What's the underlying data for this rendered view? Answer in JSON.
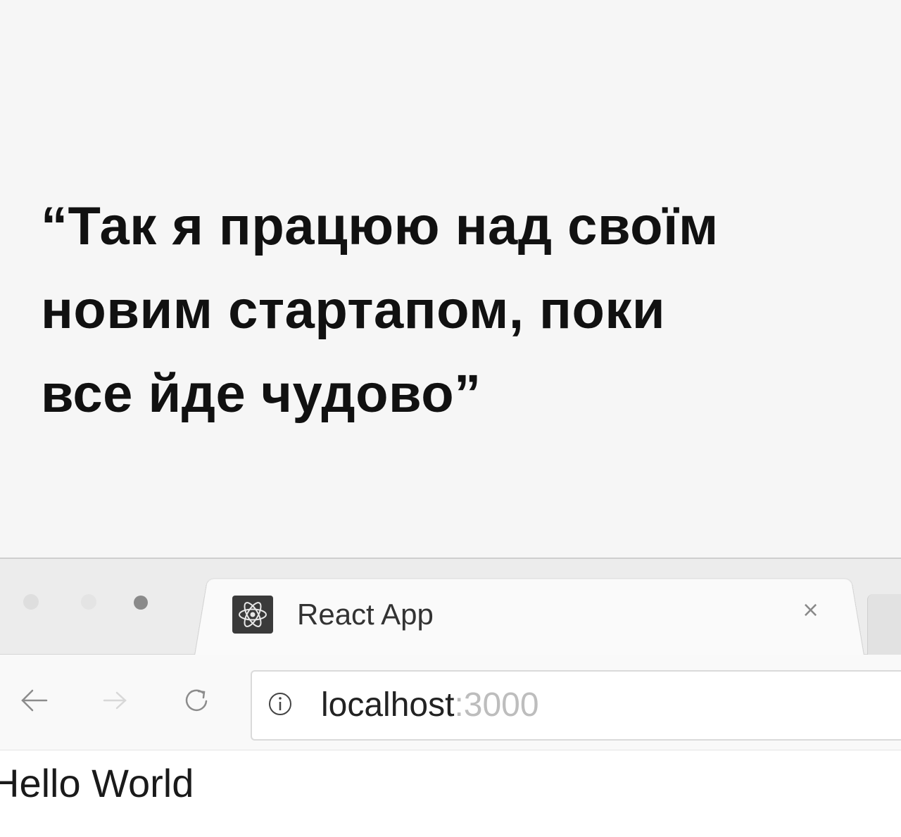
{
  "meme": {
    "caption_lines": [
      "“Так я працюю над своїм",
      "новим стартапом, поки",
      "все йде чудово”"
    ]
  },
  "browser": {
    "tab": {
      "title": "React App",
      "close_label": "×",
      "favicon": "react-logo-icon"
    },
    "toolbar": {
      "back_icon": "arrow-left-icon",
      "forward_icon": "arrow-right-icon",
      "reload_icon": "reload-icon",
      "info_icon": "info-circle-icon"
    },
    "address": {
      "host": "localhost",
      "port": ":3000"
    }
  },
  "page": {
    "heading": "Hello World"
  },
  "colors": {
    "background": "#f6f6f6",
    "caption_text": "#111111",
    "url_port": "#bdbdbd"
  }
}
